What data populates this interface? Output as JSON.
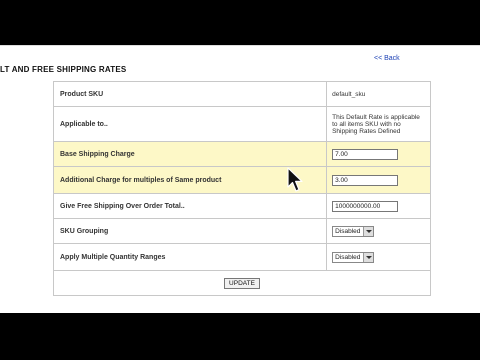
{
  "page": {
    "title": "LT AND FREE SHIPPING RATES",
    "back_link": "<< Back"
  },
  "rows": [
    {
      "label": "Product SKU",
      "value": "default_sku"
    },
    {
      "label": "Applicable to..",
      "value": "This Default Rate is applicable to all items SKU with no Shipping Rates Defined"
    },
    {
      "label": "Base Shipping Charge",
      "value": "7.00"
    },
    {
      "label": "Additional Charge for multiples of Same product",
      "value": "3.00"
    },
    {
      "label": "Give Free Shipping Over Order Total..",
      "value": "1000000000.00"
    },
    {
      "label": "SKU Grouping",
      "value": "Disabled"
    },
    {
      "label": "Apply Multiple Quantity Ranges",
      "value": "Disabled"
    }
  ],
  "update_button": "UPDATE",
  "colors": {
    "highlight_row": "#fdf8c7",
    "link": "#1a3fb4",
    "border": "#c8c8c8"
  },
  "icons": {
    "cursor": "arrow-pointer-icon",
    "dropdown": "chevron-down-icon"
  }
}
